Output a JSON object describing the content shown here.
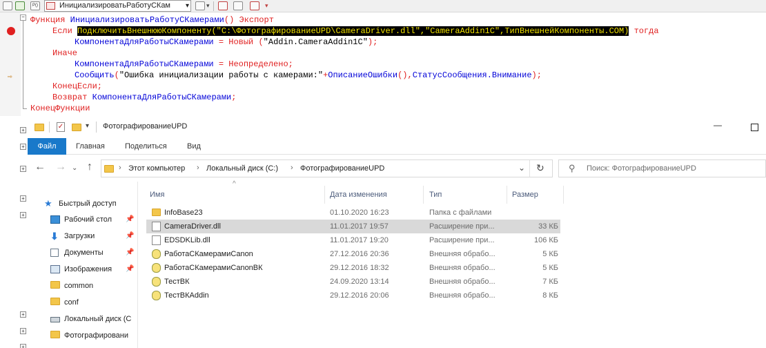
{
  "topbar": {
    "procedure_selector": "ИнициализироватьРаботуСКам"
  },
  "code": {
    "l1_kw": "Функция",
    "l1_name": "ИнициализироватьРаботуСКамерами",
    "l1_paren": "()",
    "l1_export": "Экспорт",
    "l2_if": "Если",
    "l2_func": "ПодключитьВнешнююКомпоненту",
    "l2_p1": "(",
    "l2_s1": "\"C:\\ФотографированиеUPD\\CameraDriver.dll\"",
    "l2_comma1": ",",
    "l2_s2": "\"CameraAddin1C\"",
    "l2_comma2": ",",
    "l2_type": "ТипВнешнейКомпоненты.COM",
    "l2_p2": ")",
    "l2_then": "тогда",
    "l3_var": "КомпонентаДляРаботыСКамерами",
    "l3_eq": " = ",
    "l3_new": "Новый",
    "l3_p1": " (",
    "l3_s": "\"Addin.CameraAddin1C\"",
    "l3_p2": ");",
    "l4_else": "Иначе",
    "l5_var": "КомпонентаДляРаботыСКамерами",
    "l5_eq": " = ",
    "l5_undef": "Неопределено",
    "l5_semi": ";",
    "l6_func": "Сообщить",
    "l6_p1": "(",
    "l6_s": "\"Ошибка инициализации работы с камерами:\"",
    "l6_plus": "+",
    "l6_desc": "ОписаниеОшибки",
    "l6_p2": "(),",
    "l6_status": "СтатусСообщения.Внимание",
    "l6_end": ");",
    "l7_endif": "КонецЕсли;",
    "l8_return": "Возврат",
    "l8_var": "КомпонентаДляРаботыСКамерами",
    "l8_semi": ";",
    "l9_end": "КонецФункции"
  },
  "window": {
    "title": "ФотографированиеUPD",
    "minimize_glyph": "—",
    "maximize_glyph": "☐"
  },
  "ribbon": {
    "tabs": [
      "Файл",
      "Главная",
      "Поделиться",
      "Вид"
    ]
  },
  "address": {
    "crumbs": [
      "Этот компьютер",
      "Локальный диск (C:)",
      "ФотографированиеUPD"
    ],
    "search_placeholder": "Поиск: ФотографированиеUPD",
    "dropdown_glyph": "⌄",
    "refresh_glyph": "↻"
  },
  "nav_pane": {
    "quick_access": "Быстрый доступ",
    "items": [
      {
        "label": "Рабочий стол",
        "icon": "desktop-icon",
        "pinned": true
      },
      {
        "label": "Загрузки",
        "icon": "download-icon",
        "pinned": true
      },
      {
        "label": "Документы",
        "icon": "documents-icon",
        "pinned": true
      },
      {
        "label": "Изображения",
        "icon": "pictures-icon",
        "pinned": true
      },
      {
        "label": "common",
        "icon": "folder-icon",
        "pinned": false
      },
      {
        "label": "conf",
        "icon": "folder-icon",
        "pinned": false
      },
      {
        "label": "Локальный диск (C",
        "icon": "drive-icon",
        "pinned": false
      },
      {
        "label": "Фотографировани",
        "icon": "folder-icon",
        "pinned": false
      }
    ]
  },
  "file_list": {
    "columns": [
      "Имя",
      "Дата изменения",
      "Тип",
      "Размер"
    ],
    "rows": [
      {
        "name": "InfoBase23",
        "date": "01.10.2020 16:23",
        "type": "Папка с файлами",
        "size": "",
        "icon": "folder-icon"
      },
      {
        "name": "CameraDriver.dll",
        "date": "11.01.2017 19:57",
        "type": "Расширение при...",
        "size": "33 КБ",
        "icon": "dll-file-icon",
        "selected": true
      },
      {
        "name": "EDSDKLib.dll",
        "date": "11.01.2017 19:20",
        "type": "Расширение при...",
        "size": "106 КБ",
        "icon": "dll-file-icon"
      },
      {
        "name": "РаботаСКамерамиCanon",
        "date": "27.12.2016 20:36",
        "type": "Внешняя обрабо...",
        "size": "5 КБ",
        "icon": "epf-file-icon"
      },
      {
        "name": "РаботаСКамерамиCanonВК",
        "date": "29.12.2016 18:32",
        "type": "Внешняя обрабо...",
        "size": "5 КБ",
        "icon": "epf-file-icon"
      },
      {
        "name": "ТестВК",
        "date": "24.09.2020 13:14",
        "type": "Внешняя обрабо...",
        "size": "7 КБ",
        "icon": "epf-file-icon"
      },
      {
        "name": "ТестВКAddin",
        "date": "29.12.2016 20:06",
        "type": "Внешняя обрабо...",
        "size": "8 КБ",
        "icon": "epf-file-icon"
      }
    ]
  },
  "colors": {
    "keyword": "#e02020",
    "identifier": "#0000d8",
    "highlight_bg": "#000000",
    "highlight_fg": "#f0e000",
    "ribbon_active": "#1979ca"
  }
}
